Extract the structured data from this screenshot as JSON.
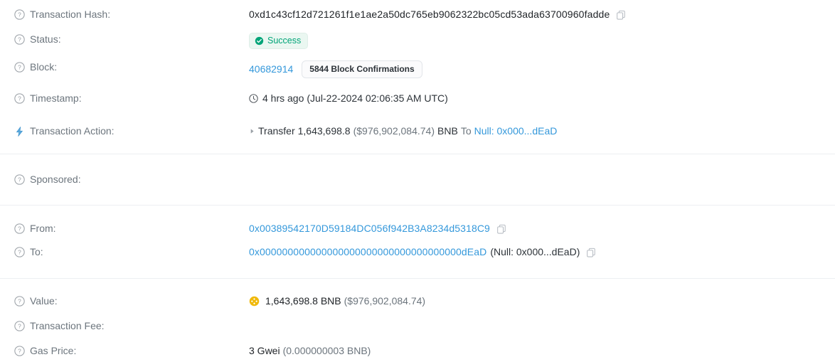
{
  "rows": {
    "transaction_hash": {
      "label": "Transaction Hash:",
      "value": "0xd1c43cf12d721261f1e1ae2a50dc765eb9062322bc05cd53ada63700960fadde",
      "copy_icon": "copy-icon",
      "help_icon": "question-circle-icon"
    },
    "status": {
      "label": "Status:",
      "badge_text": "Success",
      "badge_icon": "check-circle-icon",
      "badge_bg": "#eaf7f1",
      "badge_color": "#00a478",
      "help_icon": "question-circle-icon"
    },
    "block": {
      "label": "Block:",
      "number": "40682914",
      "confirmations": "5844 Block Confirmations",
      "help_icon": "question-circle-icon"
    },
    "timestamp": {
      "label": "Timestamp:",
      "relative": "4 hrs ago",
      "absolute": "(Jul-22-2024 02:06:35 AM UTC)",
      "clock_icon": "clock-icon",
      "help_icon": "question-circle-icon"
    },
    "transaction_action": {
      "label": "Transaction Action:",
      "icon": "lightning-bolt-icon",
      "verb": "Transfer",
      "amount": "1,643,698.8",
      "usd": "($976,902,084.74)",
      "token": "BNB",
      "preposition": "To",
      "destination": "Null: 0x000...dEaD",
      "caret_icon": "caret-right-icon"
    },
    "sponsored": {
      "label": "Sponsored:",
      "value": "",
      "help_icon": "question-circle-icon"
    },
    "from": {
      "label": "From:",
      "address": "0x00389542170D59184DC056f942B3A8234d5318C9",
      "copy_icon": "copy-icon",
      "help_icon": "question-circle-icon"
    },
    "to": {
      "label": "To:",
      "address": "0x000000000000000000000000000000000000dEaD",
      "note": "(Null: 0x000...dEaD)",
      "copy_icon": "copy-icon",
      "help_icon": "question-circle-icon"
    },
    "value": {
      "label": "Value:",
      "coin_icon": "bnb-coin-icon",
      "amount": "1,643,698.8 BNB",
      "usd": "($976,902,084.74)",
      "help_icon": "question-circle-icon"
    },
    "transaction_fee": {
      "label": "Transaction Fee:",
      "value": "",
      "help_icon": "question-circle-icon"
    },
    "gas_price": {
      "label": "Gas Price:",
      "amount": "3 Gwei",
      "native": "(0.000000003 BNB)",
      "help_icon": "question-circle-icon"
    }
  },
  "colors": {
    "link": "#3498db",
    "success": "#00a478",
    "muted": "#6c757d",
    "text": "#212529",
    "divider": "#edeff2",
    "bnb_gold": "#f0b90b"
  }
}
